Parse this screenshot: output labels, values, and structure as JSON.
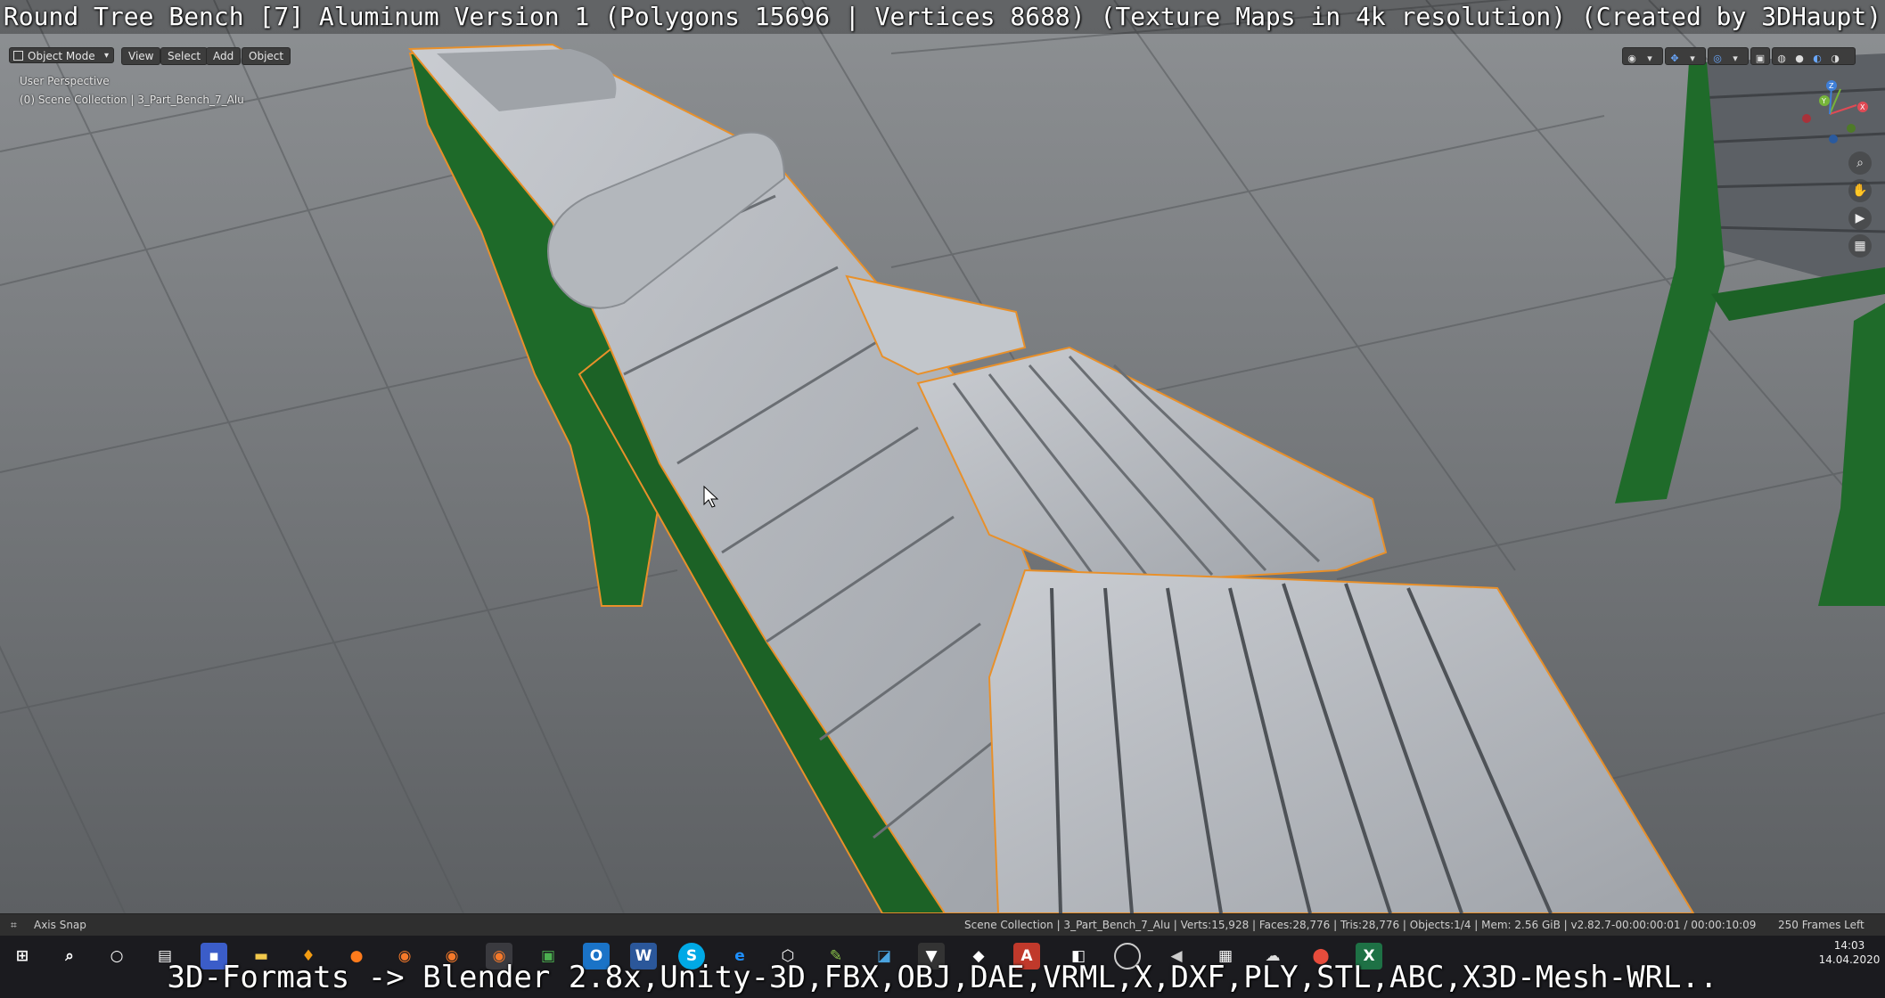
{
  "video_overlay": {
    "title": "Round Tree Bench [7] Aluminum Version 1 (Polygons 15696 | Vertices 8688) (Texture Maps in 4k resolution) (Created by 3DHaupt)",
    "caption": "3D-Formats -> Blender 2.8x,Unity-3D,FBX,OBJ,DAE,VRML,X,DXF,PLY,STL,ABC,X3D-Mesh-WRL.."
  },
  "header": {
    "mode_select": "Object Mode",
    "menus": [
      "View",
      "Select",
      "Add",
      "Object"
    ]
  },
  "viewport": {
    "perspective_label": "User Perspective",
    "collection_label": "(0) Scene Collection | 3_Part_Bench_7_Alu",
    "gizmo_axes": [
      "X",
      "Y",
      "Z"
    ],
    "colors": {
      "selection_outline": "#e8902a",
      "frame_green": "#1f6b2a",
      "slat_gray": "#b8bcc2",
      "x_axis": "#e04a55",
      "y_axis": "#77b53a",
      "z_axis": "#3f7fd8"
    },
    "nav_icons": [
      "zoom-icon",
      "hand-pan-icon",
      "camera-icon",
      "ortho-grid-icon"
    ]
  },
  "status_bar": {
    "left_hint": "Axis Snap",
    "stats": "Scene Collection | 3_Part_Bench_7_Alu | Verts:15,928 | Faces:28,776 | Tris:28,776 | Objects:1/4 | Mem: 2.56 GiB | v2.82.7",
    "timecode": "-00:00:00:01 / 00:00:10:09",
    "frames_left": "250 Frames Left"
  },
  "taskbar": {
    "clock_time": "14:03",
    "clock_date": "14.04.2020",
    "apps": [
      "windows-start",
      "search",
      "cortana",
      "task-view",
      "save",
      "file-explorer",
      "blender-flame",
      "firefox",
      "blender",
      "blender",
      "blender-active",
      "image-viewer",
      "outlook",
      "word",
      "skype",
      "edge",
      "3d-viewer",
      "sketch",
      "photo",
      "vivaldi",
      "unity",
      "acrobat",
      "unity-hub",
      "obs",
      "vs-code",
      "calculator",
      "paint",
      "maps-pin",
      "excel"
    ]
  }
}
